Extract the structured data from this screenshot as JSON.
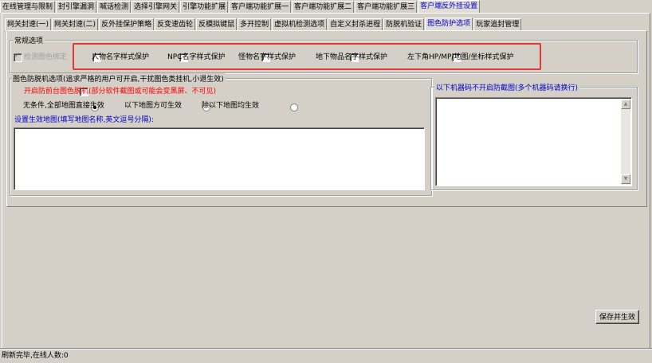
{
  "top_tabs": [
    "在线管理与限制",
    "封引擎漏洞",
    "喊话检测",
    "选择引擎网关",
    "引擎功能扩展",
    "客户端功能扩展一",
    "客户端功能扩展二",
    "客户端功能扩展三",
    "客户端反外挂设置"
  ],
  "sub_tabs": [
    "网关封速(一)",
    "网关封速(二)",
    "反外挂保护策略",
    "反变速齿轮",
    "反模拟键鼠",
    "多开控制",
    "虚拟机检测选项",
    "自定义封杀进程",
    "防脱机验证",
    "图色防护选项",
    "玩家追封管理"
  ],
  "general": {
    "legend": "常规选项",
    "detect_bind": "检测图色绑定",
    "options": [
      "人物名字样式保护",
      "NPC名字样式保护",
      "怪物名字样式保护",
      "地下物品名字样式保护",
      "左下角HP/MP/地图/坐标样式保护"
    ]
  },
  "anti_bot": {
    "legend": "图色防脱机选项(追求严格的用户可开启,干扰图色类挂机,小退生效)",
    "enable_label": "开启防前台图色脱机(部分软件截图或可能会变黑屏、不可见)",
    "radios": [
      "无条件,全部地图直接生效",
      "以下地图方可生效",
      "除以下地图均生效"
    ],
    "map_setting_label": "设置生效地图(填写地图名称,英文逗号分隔):"
  },
  "machine_codes": {
    "legend": "以下机器码不开启防截图(多个机器码请换行)"
  },
  "buttons": {
    "save": "保存并生效"
  },
  "status_bar": {
    "text": "刷新完毕,在线人数:0"
  },
  "colors": {
    "highlight": "#e53935",
    "active_tab_text": "#0000c8",
    "warning_text": "#ff0000",
    "link_text": "#0000c8"
  }
}
